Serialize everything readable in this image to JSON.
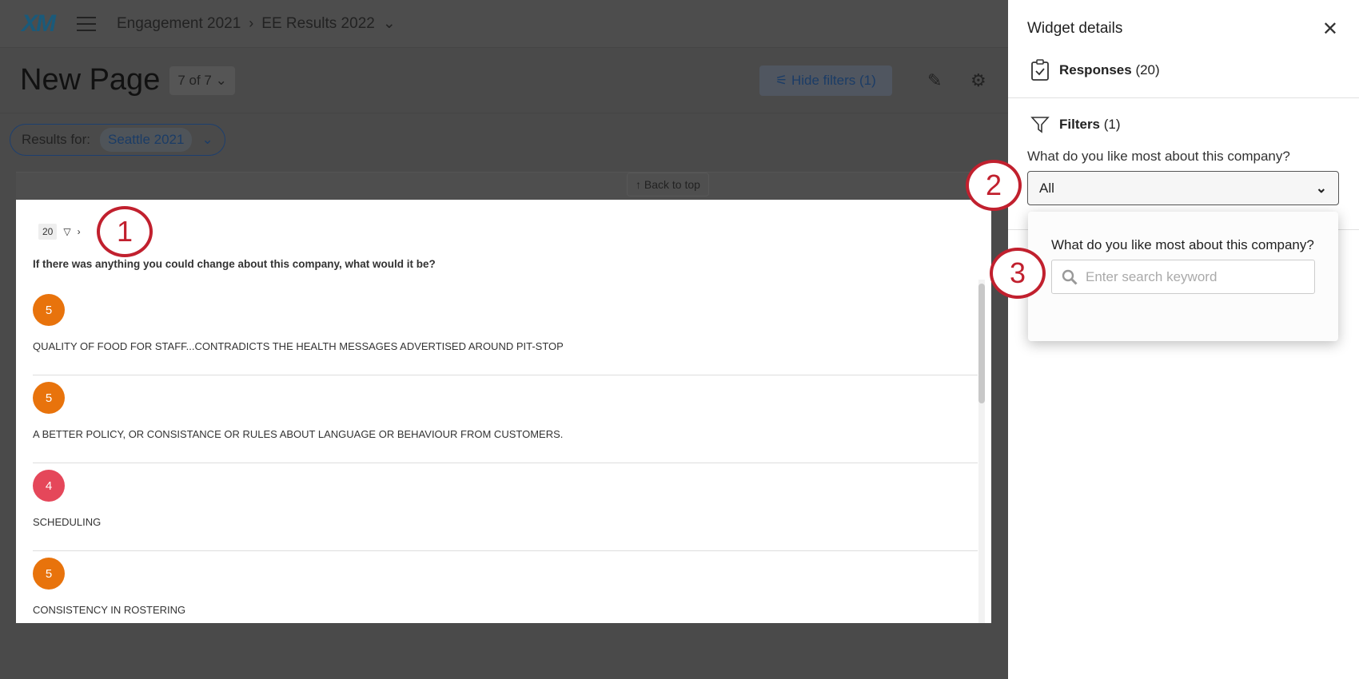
{
  "header": {
    "logo": "XM",
    "breadcrumb": [
      "Engagement 2021",
      "EE Results 2022"
    ]
  },
  "page": {
    "title": "New Page",
    "pager": "7 of 7",
    "hide_filters": "Hide filters (1)",
    "results_for_label": "Results for:",
    "results_for_value": "Seattle 2021",
    "back_to_top": "Back to top"
  },
  "widget": {
    "count": "20",
    "question": "If there was anything you could change about this company, what would it be?",
    "responses": [
      {
        "score": "5",
        "text": "QUALITY OF FOOD FOR STAFF...CONTRADICTS THE HEALTH MESSAGES ADVERTISED AROUND PIT-STOP",
        "color": "#e8730c"
      },
      {
        "score": "5",
        "text": "A BETTER POLICY, OR CONSISTANCE OR RULES ABOUT LANGUAGE OR BEHAVIOUR FROM CUSTOMERS.",
        "color": "#e8730c"
      },
      {
        "score": "4",
        "text": "SCHEDULING",
        "color": "#e5475a"
      },
      {
        "score": "5",
        "text": "CONSISTENCY IN ROSTERING",
        "color": "#e8730c"
      }
    ]
  },
  "panel": {
    "title": "Widget details",
    "responses_label": "Responses",
    "responses_count": "(20)",
    "filters_label": "Filters",
    "filters_count": "(1)",
    "filter_question": "What do you like most about this company?",
    "filter_value": "All",
    "popover": {
      "label": "What do you like most about this company?",
      "placeholder": "Enter search keyword"
    }
  },
  "callouts": [
    "1",
    "2",
    "3"
  ]
}
